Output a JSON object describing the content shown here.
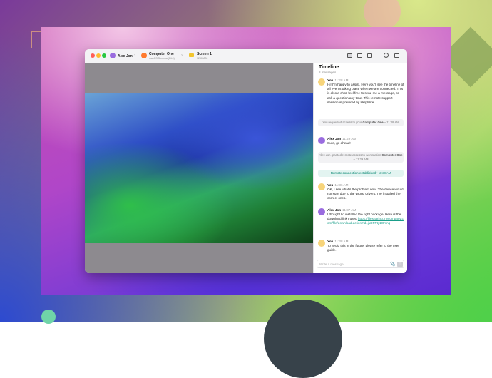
{
  "window": {
    "user_name": "Alex Jon",
    "computer": {
      "name": "Computer One",
      "os": "macOS Sonoma (14.0)"
    },
    "screen": {
      "name": "Screen 1",
      "resolution": "1280x800"
    },
    "toolbar_icons": [
      "layout-full-icon",
      "layout-split-icon",
      "layout-columns-icon",
      "settings-icon",
      "monitor-icon"
    ]
  },
  "timeline": {
    "title": "Timeline",
    "count": "8 messages",
    "messages": [
      {
        "author": "You",
        "time": "11:28 AM",
        "text": "Hi! I'm happy to assist. Here you'll see the timeline of all events taking place when we are connected. This is also a chat, feel free to send me a message, or ask a question any time. This remote support session is powered by HelpWire."
      },
      {
        "author": "Alex Jon",
        "time": "11:29 AM",
        "text": "Sure, go ahead!"
      },
      {
        "author": "You",
        "time": "11:36 AM",
        "text": "OK, I see what's the problem now. The device would not start due to the wrong drivers. I've installed the correct ones."
      },
      {
        "author": "Alex Jon",
        "time": "11:37 AM",
        "text": "I thought I'd installed the right package. Here is the download link I used ",
        "link": "https://filesharing.mycompany.com/file/download.action?id=juDFPty1Omng"
      },
      {
        "author": "You",
        "time": "11:38 AM",
        "text": "To avoid this in the future, please refer to the user guide."
      }
    ],
    "system": [
      {
        "pre": "You requested access to your ",
        "bold": "Computer One",
        "post": " – 11:28 AM"
      },
      {
        "pre": "Alex Jon granted remote access to workstation ",
        "bold": "Computer One",
        "post": " – 11:29 AM"
      },
      {
        "pre": "",
        "bold": "Remote connection established",
        "post": " • 11:28 AM"
      }
    ],
    "composer_placeholder": "Write a message...",
    "colors": {
      "accent": "#1a9e8a",
      "you_avatar": "#f7d47a",
      "alex_avatar": "#9a6cdf"
    }
  }
}
